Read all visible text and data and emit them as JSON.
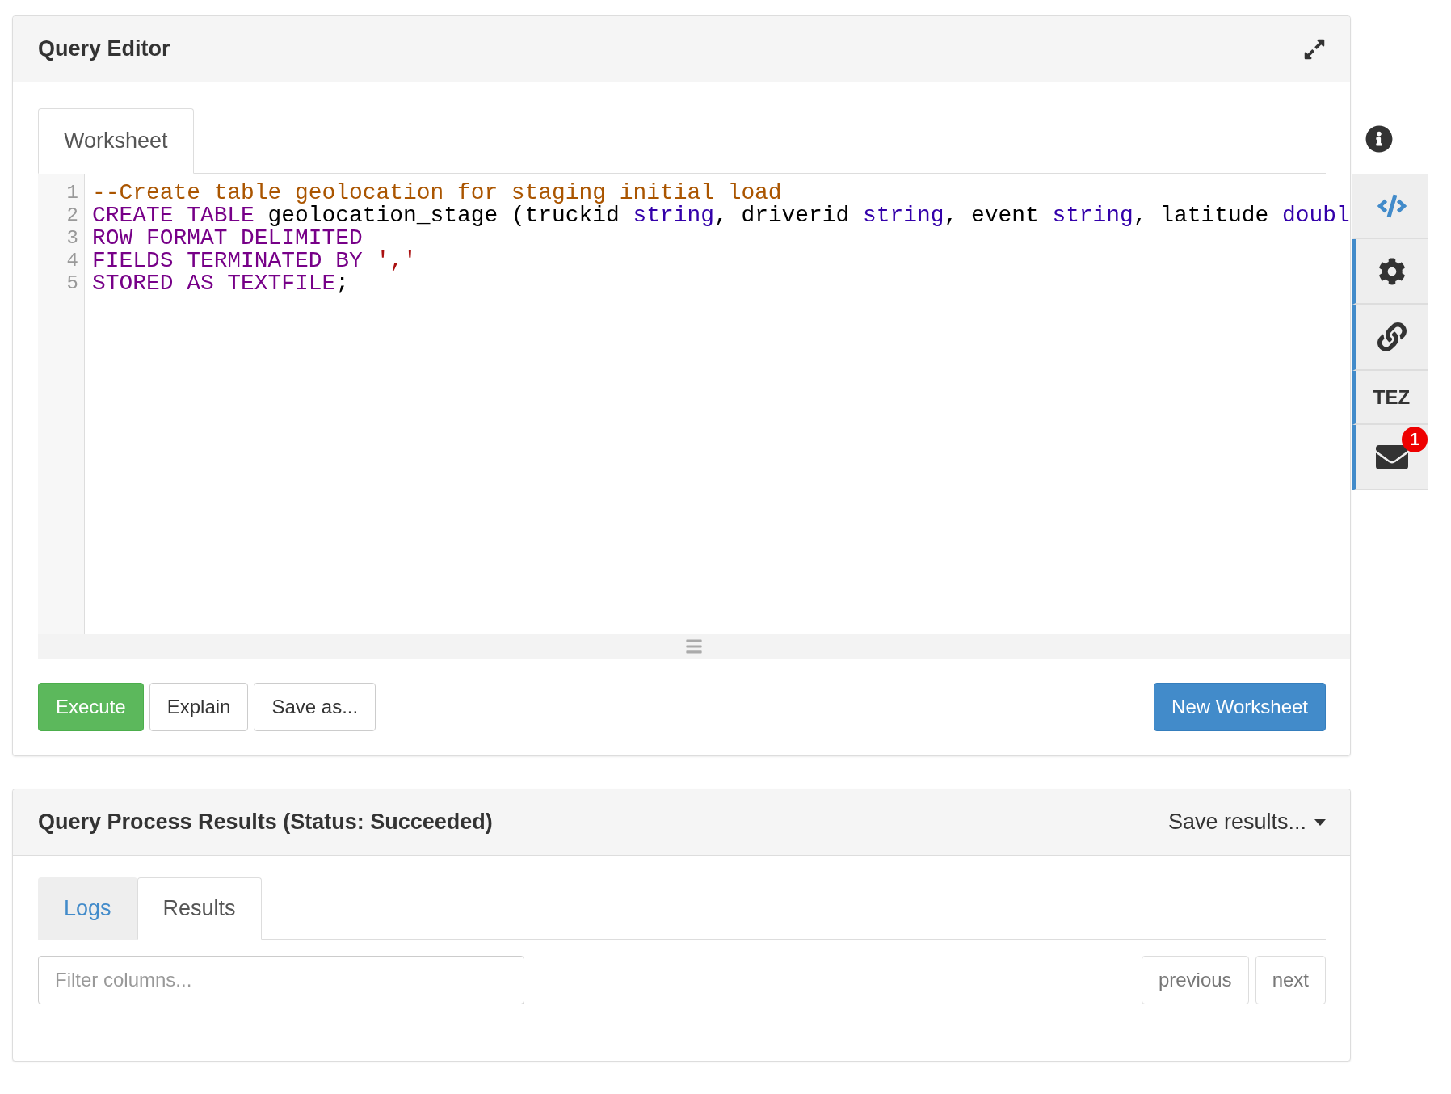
{
  "query_editor": {
    "title": "Query Editor",
    "tabs": [
      {
        "label": "Worksheet",
        "selected": true
      }
    ],
    "lines": [
      {
        "number": "1",
        "tokens": [
          {
            "kind": "comment",
            "text": "--Create table geolocation for staging initial load"
          }
        ]
      },
      {
        "number": "2",
        "tokens": [
          {
            "kind": "keyword",
            "text": "CREATE TABLE"
          },
          {
            "kind": "plain",
            "text": " geolocation_stage (truckid "
          },
          {
            "kind": "type",
            "text": "string"
          },
          {
            "kind": "plain",
            "text": ", driverid "
          },
          {
            "kind": "type",
            "text": "string"
          },
          {
            "kind": "plain",
            "text": ", event "
          },
          {
            "kind": "type",
            "text": "string"
          },
          {
            "kind": "plain",
            "text": ", latitude "
          },
          {
            "kind": "type",
            "text": "doubl"
          }
        ]
      },
      {
        "number": "3",
        "tokens": [
          {
            "kind": "keyword",
            "text": "ROW FORMAT DELIMITED"
          }
        ]
      },
      {
        "number": "4",
        "tokens": [
          {
            "kind": "keyword",
            "text": "FIELDS TERMINATED BY "
          },
          {
            "kind": "string",
            "text": "','"
          }
        ]
      },
      {
        "number": "5",
        "tokens": [
          {
            "kind": "keyword",
            "text": "STORED AS TEXTFILE"
          },
          {
            "kind": "plain",
            "text": ";"
          }
        ]
      }
    ],
    "buttons": [
      {
        "label": "Execute",
        "kind": "success"
      },
      {
        "label": "Explain",
        "kind": "default"
      },
      {
        "label": "Save as...",
        "kind": "default"
      }
    ],
    "new_worksheet": "New Worksheet"
  },
  "sidebar": {
    "items": [
      {
        "kind": "code",
        "selected": true
      },
      {
        "kind": "settings",
        "selected": false
      },
      {
        "kind": "link",
        "selected": false
      },
      {
        "kind": "text",
        "label": "TEZ",
        "selected": false
      },
      {
        "kind": "mail",
        "badge": "1",
        "selected": false
      }
    ]
  },
  "results": {
    "title": "Query Process Results (Status: Succeeded)",
    "save_results": "Save results...",
    "tabs": [
      {
        "label": "Logs",
        "selected": false
      },
      {
        "label": "Results",
        "selected": true
      }
    ],
    "filter": {
      "placeholder": "Filter columns..."
    },
    "pager": [
      "previous",
      "next"
    ]
  }
}
